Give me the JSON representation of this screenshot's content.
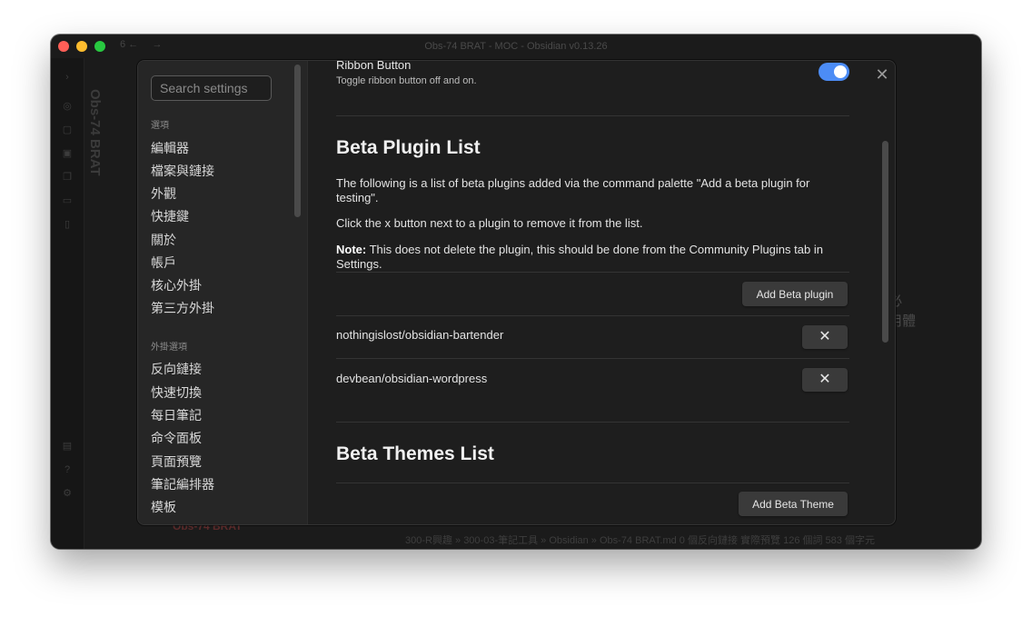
{
  "window": {
    "title": "Obs-74 BRAT - MOC - Obsidian v0.13.26",
    "tab_count": "6"
  },
  "background": {
    "note_title": "Obs-74 BRAT",
    "right_text_1": "必",
    "right_text_2": "用體",
    "heading": "Obs-74 BRAT",
    "statusbar": "300-R興趣 » 300-03-筆記工具 » Obsidian » Obs-74 BRAT.md  0 個反向鏈接  實際預覽  126 個詞  583 個字元"
  },
  "settings": {
    "search": {
      "placeholder": "Search settings"
    },
    "sidebar": {
      "options_heading": "選項",
      "options": [
        "編輯器",
        "檔案與鏈接",
        "外觀",
        "快捷鍵",
        "關於",
        "帳戶",
        "核心外掛",
        "第三方外掛"
      ],
      "plugin_heading": "外掛選項",
      "plugin_options": [
        "反向鏈接",
        "快速切換",
        "每日筆記",
        "命令面板",
        "頁面預覽",
        "筆記編排器",
        "模板"
      ]
    },
    "ribbon": {
      "name": "Ribbon Button",
      "description": "Toggle ribbon button off and on.",
      "enabled": true
    },
    "beta_plugins": {
      "title": "Beta Plugin List",
      "para1": "The following is a list of beta plugins added via the command palette \"Add a beta plugin for testing\".",
      "para2": "Click the x button next to a plugin to remove it from the list.",
      "note_label": "Note:",
      "note_text": " This does not delete the plugin, this should be done from the Community Plugins tab in Settings.",
      "add_button": "Add Beta plugin",
      "plugins": [
        "nothingislost/obsidian-bartender",
        "devbean/obsidian-wordpress"
      ],
      "remove_glyph": "✕"
    },
    "beta_themes": {
      "title": "Beta Themes List",
      "add_button": "Add Beta Theme"
    },
    "close_glyph": "✕"
  },
  "colors": {
    "accent": "#4c8cf5",
    "background": "#1e1e1e"
  }
}
